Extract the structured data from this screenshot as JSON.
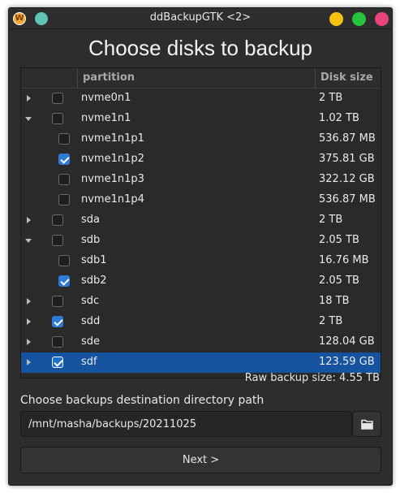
{
  "window": {
    "title": "ddBackupGTK <2>",
    "app_icon": "W"
  },
  "heading": "Choose disks to backup",
  "table": {
    "columns": [
      "partition",
      "Disk size"
    ],
    "rows": [
      {
        "name": "nvme0n1",
        "size": "2 TB",
        "level": 0,
        "expander": "collapsed",
        "checked": false,
        "selected": false
      },
      {
        "name": "nvme1n1",
        "size": "1.02 TB",
        "level": 0,
        "expander": "expanded",
        "checked": false,
        "selected": false
      },
      {
        "name": "nvme1n1p1",
        "size": "536.87 MB",
        "level": 1,
        "expander": "none",
        "checked": false,
        "selected": false
      },
      {
        "name": "nvme1n1p2",
        "size": "375.81 GB",
        "level": 1,
        "expander": "none",
        "checked": true,
        "selected": false
      },
      {
        "name": "nvme1n1p3",
        "size": "322.12 GB",
        "level": 1,
        "expander": "none",
        "checked": false,
        "selected": false
      },
      {
        "name": "nvme1n1p4",
        "size": "536.87 MB",
        "level": 1,
        "expander": "none",
        "checked": false,
        "selected": false
      },
      {
        "name": "sda",
        "size": "2 TB",
        "level": 0,
        "expander": "collapsed",
        "checked": false,
        "selected": false
      },
      {
        "name": "sdb",
        "size": "2.05 TB",
        "level": 0,
        "expander": "expanded",
        "checked": false,
        "selected": false
      },
      {
        "name": "sdb1",
        "size": "16.76 MB",
        "level": 1,
        "expander": "none",
        "checked": false,
        "selected": false
      },
      {
        "name": "sdb2",
        "size": "2.05 TB",
        "level": 1,
        "expander": "none",
        "checked": true,
        "selected": false
      },
      {
        "name": "sdc",
        "size": "18 TB",
        "level": 0,
        "expander": "collapsed",
        "checked": false,
        "selected": false
      },
      {
        "name": "sdd",
        "size": "2 TB",
        "level": 0,
        "expander": "collapsed",
        "checked": true,
        "selected": false
      },
      {
        "name": "sde",
        "size": "128.04 GB",
        "level": 0,
        "expander": "collapsed",
        "checked": false,
        "selected": false
      },
      {
        "name": "sdf",
        "size": "123.59 GB",
        "level": 0,
        "expander": "collapsed",
        "checked": true,
        "selected": true
      }
    ]
  },
  "raw_backup_size": "Raw backup size: 4.55 TB",
  "destination": {
    "label": "Choose backups destination directory path",
    "path": "/mnt/masha/backups/20211025",
    "browse_icon": "folder-icon"
  },
  "next_button": "Next >",
  "colors": {
    "selection": "#15539e",
    "checkbox_checked": "#2f7ad6",
    "background": "#2d2d2d"
  }
}
